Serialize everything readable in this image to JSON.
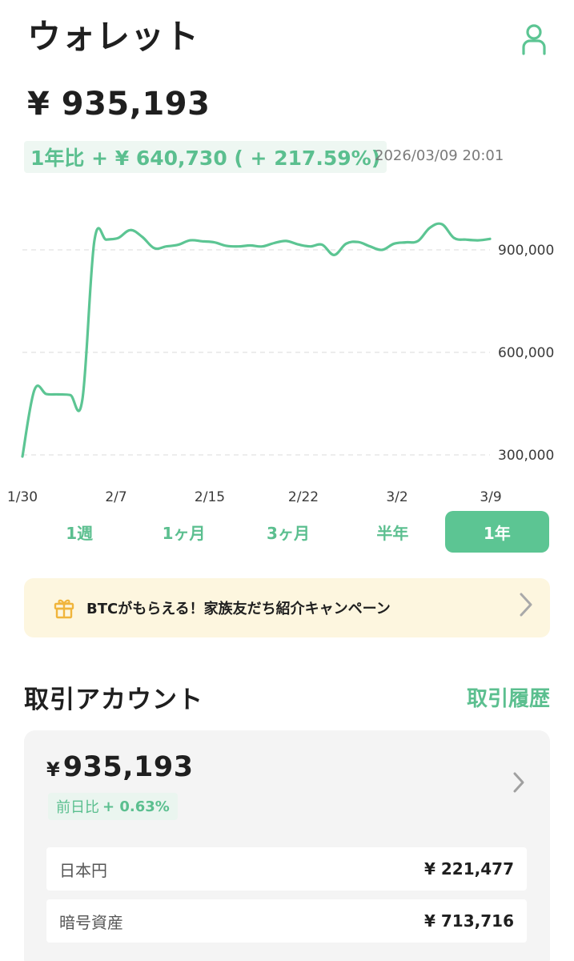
{
  "header": {
    "title": "ウォレット",
    "user_icon": "user-icon"
  },
  "summary": {
    "total_balance": "¥ 935,193",
    "change_text": "1年比 + ¥ 640,730 ( + 217.59%)",
    "timestamp": "2026/03/09 20:01"
  },
  "chart_data": {
    "type": "line",
    "x_tick_labels": [
      "1/30",
      "2/7",
      "2/15",
      "2/22",
      "3/2",
      "3/9"
    ],
    "y_tick_labels": [
      "900,000",
      "600,000",
      "300,000"
    ],
    "y_ticks": [
      900000,
      600000,
      300000
    ],
    "ylim": [
      290000,
      1000000
    ],
    "grid": "dashed horizontal",
    "color": "#5cc593",
    "series": [
      {
        "values": [
          295000,
          490000,
          478000,
          477000,
          475000,
          462000,
          925000,
          930000,
          935000,
          958000,
          938000,
          905000,
          910000,
          915000,
          928000,
          925000,
          922000,
          912000,
          910000,
          913000,
          910000,
          920000,
          926000,
          916000,
          910000,
          915000,
          885000,
          918000,
          923000,
          910000,
          900000,
          918000,
          922000,
          926000,
          965000,
          975000,
          935000,
          930000,
          928000,
          932000
        ]
      }
    ]
  },
  "period_tabs": [
    {
      "label": "1週",
      "active": false
    },
    {
      "label": "1ヶ月",
      "active": false
    },
    {
      "label": "3ヶ月",
      "active": false
    },
    {
      "label": "半年",
      "active": false
    },
    {
      "label": "1年",
      "active": true
    }
  ],
  "promo": {
    "text": "BTCがもらえる！家族友だち紹介キャンペーン",
    "icon": "gift-icon"
  },
  "account": {
    "section_title": "取引アカウント",
    "history_link": "取引履歴",
    "yen_sign": "¥",
    "balance": "935,193",
    "change_label": "前日比",
    "change_value": "+ 0.63%",
    "rows": [
      {
        "label": "日本円",
        "value": "¥ 221,477"
      },
      {
        "label": "暗号資産",
        "value": "¥ 713,716"
      }
    ]
  },
  "colors": {
    "accent": "#5cc593",
    "accent_text": "#5bbf8f",
    "promo_bg": "#fdf6df",
    "card_bg": "#f4f4f4"
  }
}
